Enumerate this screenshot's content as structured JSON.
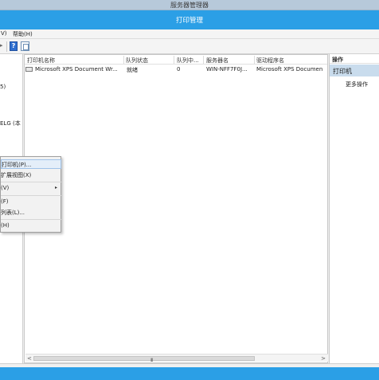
{
  "outer_title": "服务器管理器",
  "window_title": "打印管理",
  "menu": {
    "view": "V)",
    "help": "帮助(H)"
  },
  "toolbar": {
    "help_icon": "?",
    "help_icon_name": "help-icon",
    "view_icon_name": "show-hide-tree-icon"
  },
  "left_tree": {
    "items": [
      "",
      "5)",
      "",
      "ELG (本"
    ]
  },
  "columns": [
    "打印机名称",
    "队列状态",
    "队列中...",
    "服务器名",
    "驱动程序名"
  ],
  "rows": [
    {
      "name": "Microsoft XPS Document Wr...",
      "status": "就绪",
      "jobs": "0",
      "server": "WIN-NFF7F0J...",
      "driver": "Microsoft XPS Documen"
    }
  ],
  "scrollbar": {
    "left": "<",
    "right": ">",
    "grip": "III"
  },
  "actions_pane": {
    "title": "操作",
    "section": "打印机",
    "more": "更多操作"
  },
  "context_menu": {
    "items": [
      {
        "label": "打印机(P)...",
        "highlighted": true
      },
      {
        "label": "扩展视图(X)"
      },
      {
        "label": "(V)",
        "submenu": true
      },
      {
        "label": "(F)"
      },
      {
        "label": "列表(L)..."
      },
      {
        "label": "(H)"
      }
    ]
  },
  "colors": {
    "title_blue": "#2b9fe6",
    "selection": "#c9dced"
  }
}
